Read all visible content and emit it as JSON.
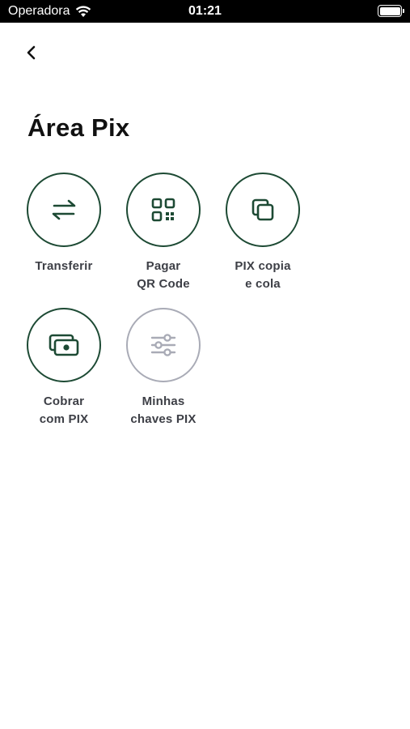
{
  "status_bar": {
    "carrier": "Operadora",
    "time": "01:21"
  },
  "header": {
    "title": "Área Pix"
  },
  "colors": {
    "primary": "#1d4a34",
    "disabled": "#a9abb6",
    "label": "#3d3f46"
  },
  "actions": [
    {
      "icon": "transfer-arrows-icon",
      "line1": "Transferir",
      "line2": "",
      "enabled": true
    },
    {
      "icon": "qr-code-icon",
      "line1": "Pagar",
      "line2": "QR Code",
      "enabled": true
    },
    {
      "icon": "copy-icon",
      "line1": "PIX copia",
      "line2": "e cola",
      "enabled": true
    },
    {
      "icon": "money-receive-icon",
      "line1": "Cobrar",
      "line2": "com PIX",
      "enabled": true
    },
    {
      "icon": "sliders-icon",
      "line1": "Minhas",
      "line2": "chaves PIX",
      "enabled": false
    }
  ]
}
